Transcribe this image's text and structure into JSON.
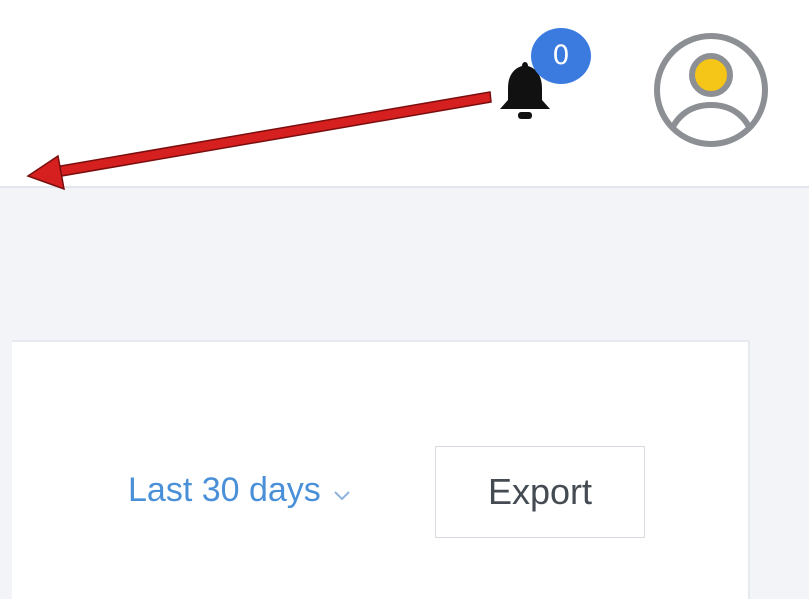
{
  "header": {
    "notifications": {
      "count": "0",
      "icon": "bell-icon"
    },
    "user_avatar_icon": "user-avatar-icon"
  },
  "toolbar": {
    "date_range": {
      "selected": "Last 30 days",
      "icon": "chevron-down-icon"
    },
    "export_label": "Export"
  },
  "colors": {
    "accent_blue": "#4a90d9",
    "badge_blue": "#3b7be0",
    "annotation_red": "#d61f1f",
    "avatar_yellow": "#f5c518",
    "page_bg": "#f2f4f8"
  }
}
